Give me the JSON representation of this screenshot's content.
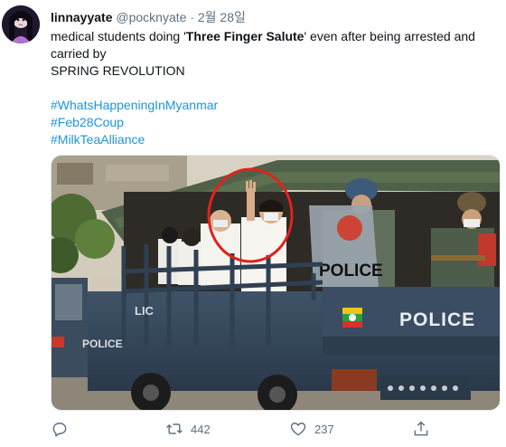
{
  "user": {
    "display_name": "linnayyate",
    "handle": "@pocknyate",
    "separator": "·",
    "date": "2월 28일"
  },
  "tweet": {
    "text_before": "medical students doing '",
    "text_bold": "Three Finger Salute",
    "text_after": "' even after being arrested and carried by",
    "line_2": "SPRING REVOLUTION",
    "hashtags": [
      "#WhatsHappeningInMyanmar",
      "#Feb28Coup",
      "#MilkTeaAlliance"
    ]
  },
  "media": {
    "truck_text_main": "POLICE",
    "truck_text_side": "POLICE",
    "truck_text_door": "POLICE",
    "shield_text": "POLICE",
    "truck_text_front": "LIC"
  },
  "actions": {
    "reply_icon": "reply-icon",
    "retweet_icon": "retweet-icon",
    "retweet_count": "442",
    "like_icon": "heart-icon",
    "like_count": "237",
    "share_icon": "share-icon"
  },
  "colors": {
    "link": "#1b95e0",
    "muted": "#5b7083",
    "text": "#0f1419",
    "highlight_circle": "#e0231d"
  }
}
